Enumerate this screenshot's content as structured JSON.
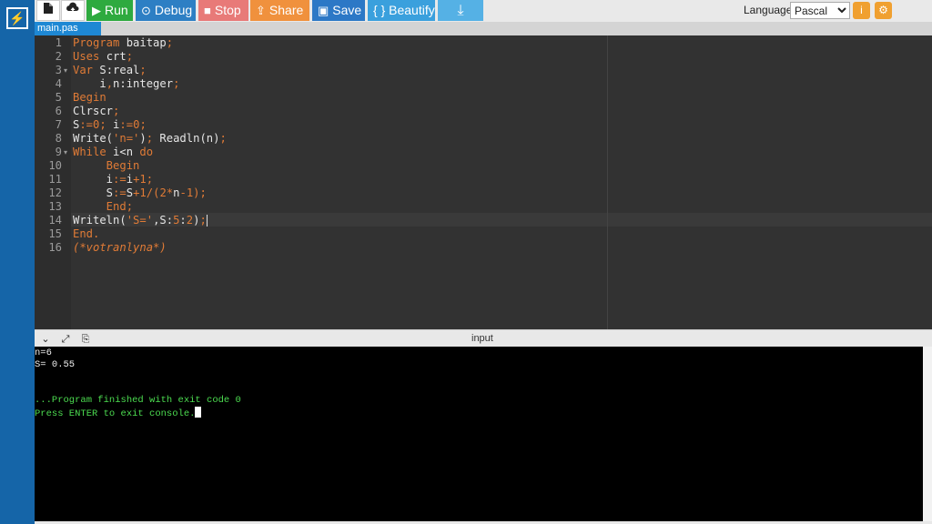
{
  "app": {
    "logo_glyph": "⚡"
  },
  "toolbar": {
    "new_file_icon": "new-file-icon",
    "upload_icon": "upload-icon",
    "run_label": "Run",
    "run_glyph": "▶",
    "debug_label": "Debug",
    "debug_glyph": "⊙",
    "stop_label": "Stop",
    "stop_glyph": "■",
    "share_label": "Share",
    "share_glyph": "⇪",
    "save_label": "Save",
    "save_glyph": "▣",
    "beautify_label": "{ } Beautify",
    "download_glyph": "⤓",
    "language_label": "Language",
    "language_value": "Pascal",
    "info_glyph": "i",
    "settings_glyph": "⚙",
    "colors": {
      "run": "#2eaa3f",
      "debug": "#2d7fc4",
      "stop": "#e87a78",
      "share": "#f0913d",
      "save": "#2c78c6",
      "beautify": "#3aa0dd",
      "download": "#55b1e5",
      "orange": "#f0a030"
    }
  },
  "editor": {
    "tab_name": "main.pas",
    "lines": [
      {
        "n": "1",
        "fold": "",
        "tokens": [
          [
            "kw",
            "Program"
          ],
          [
            "id",
            " baitap"
          ],
          [
            "kw",
            ";"
          ]
        ]
      },
      {
        "n": "2",
        "fold": "",
        "tokens": [
          [
            "kw",
            "Uses"
          ],
          [
            "id",
            " crt"
          ],
          [
            "kw",
            ";"
          ]
        ]
      },
      {
        "n": "3",
        "fold": "▾",
        "tokens": [
          [
            "kw",
            "Var"
          ],
          [
            "id",
            " S:real"
          ],
          [
            "kw",
            ";"
          ]
        ]
      },
      {
        "n": "4",
        "fold": "",
        "tokens": [
          [
            "id",
            "    i"
          ],
          [
            "kw",
            ","
          ],
          [
            "id",
            "n:integer"
          ],
          [
            "kw",
            ";"
          ]
        ]
      },
      {
        "n": "5",
        "fold": "",
        "tokens": [
          [
            "kw",
            "Begin"
          ]
        ]
      },
      {
        "n": "6",
        "fold": "",
        "tokens": [
          [
            "id",
            "Clrscr"
          ],
          [
            "kw",
            ";"
          ]
        ]
      },
      {
        "n": "7",
        "fold": "",
        "tokens": [
          [
            "id",
            "S"
          ],
          [
            "kw",
            ":="
          ],
          [
            "nm",
            "0"
          ],
          [
            "kw",
            ";"
          ],
          [
            "id",
            " i"
          ],
          [
            "kw",
            ":="
          ],
          [
            "nm",
            "0"
          ],
          [
            "kw",
            ";"
          ]
        ]
      },
      {
        "n": "8",
        "fold": "",
        "tokens": [
          [
            "id",
            "Write("
          ],
          [
            "st",
            "'n='"
          ],
          [
            "id",
            ")"
          ],
          [
            "kw",
            ";"
          ],
          [
            "id",
            " Readln(n)"
          ],
          [
            "kw",
            ";"
          ]
        ]
      },
      {
        "n": "9",
        "fold": "▾",
        "tokens": [
          [
            "kw",
            "While"
          ],
          [
            "id",
            " i<n "
          ],
          [
            "kw",
            "do"
          ]
        ]
      },
      {
        "n": "10",
        "fold": "",
        "tokens": [
          [
            "kw",
            "     Begin"
          ]
        ]
      },
      {
        "n": "11",
        "fold": "",
        "tokens": [
          [
            "id",
            "     i"
          ],
          [
            "kw",
            ":="
          ],
          [
            "id",
            "i"
          ],
          [
            "kw",
            "+"
          ],
          [
            "nm",
            "1"
          ],
          [
            "kw",
            ";"
          ]
        ]
      },
      {
        "n": "12",
        "fold": "",
        "tokens": [
          [
            "id",
            "     S"
          ],
          [
            "kw",
            ":="
          ],
          [
            "id",
            "S"
          ],
          [
            "kw",
            "+"
          ],
          [
            "nm",
            "1"
          ],
          [
            "kw",
            "/("
          ],
          [
            "nm",
            "2"
          ],
          [
            "kw",
            "*"
          ],
          [
            "id",
            "n"
          ],
          [
            "kw",
            "-"
          ],
          [
            "nm",
            "1"
          ],
          [
            "kw",
            ");"
          ]
        ]
      },
      {
        "n": "13",
        "fold": "",
        "tokens": [
          [
            "kw",
            "     End;"
          ]
        ]
      },
      {
        "n": "14",
        "fold": "",
        "tokens": [
          [
            "id",
            "Writeln("
          ],
          [
            "st",
            "'S='"
          ],
          [
            "id",
            ",S:"
          ],
          [
            "nm",
            "5"
          ],
          [
            "id",
            ":"
          ],
          [
            "nm",
            "2"
          ],
          [
            "id",
            ")"
          ],
          [
            "kw",
            ";"
          ]
        ]
      },
      {
        "n": "15",
        "fold": "",
        "tokens": [
          [
            "kw",
            "End."
          ]
        ]
      },
      {
        "n": "16",
        "fold": "",
        "tokens": [
          [
            "cm",
            "(*votranlyna*)"
          ]
        ]
      }
    ]
  },
  "console": {
    "label": "input",
    "collapse_glyph": "⌄",
    "expand_glyph": "⤢",
    "copy_glyph": "⎘",
    "lines": [
      {
        "text": "n=6",
        "color": "white"
      },
      {
        "text": "S= 0.55",
        "color": "white"
      },
      {
        "text": "",
        "color": "white"
      },
      {
        "text": "",
        "color": "white"
      },
      {
        "text": "...Program finished with exit code 0",
        "color": "green"
      },
      {
        "text": "Press ENTER to exit console.",
        "color": "green"
      }
    ]
  }
}
